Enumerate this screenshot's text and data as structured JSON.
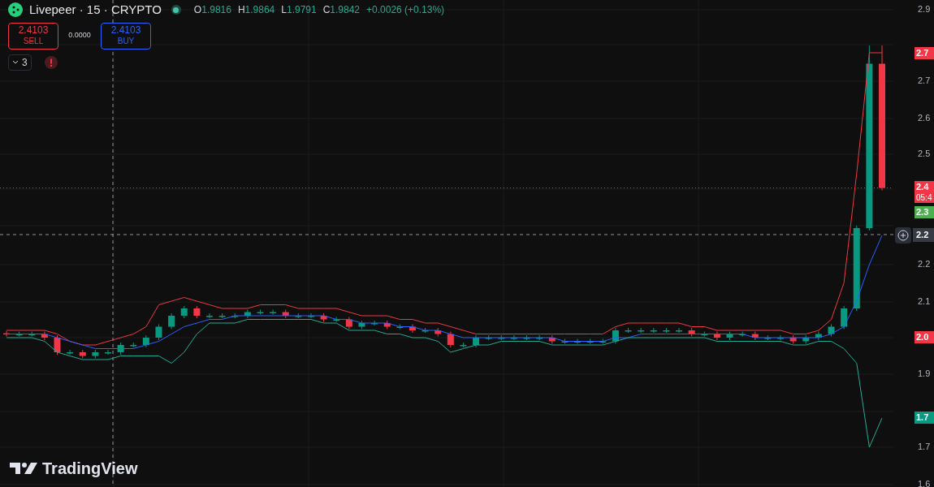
{
  "header": {
    "symbol": "Livepeer · 15 · CRYPTO",
    "market_open": true,
    "ohlc": [
      {
        "label": "O",
        "value": "1.9816"
      },
      {
        "label": "H",
        "value": "1.9864"
      },
      {
        "label": "L",
        "value": "1.9791"
      },
      {
        "label": "C",
        "value": "1.9842"
      }
    ],
    "change": "+0.0026 (+0.13%)"
  },
  "trade": {
    "sell": {
      "price": "2.4103",
      "label": "SELL"
    },
    "spread": "0.0000",
    "buy": {
      "price": "2.4103",
      "label": "BUY"
    }
  },
  "indicators": {
    "count": "3",
    "warning": true
  },
  "chart": {
    "price_axis": [
      "2.9",
      "2.7",
      "2.6",
      "2.5",
      "2.2",
      "2.1",
      "1.9",
      "1.7",
      "1.6"
    ],
    "badges": [
      {
        "text": "2.7",
        "color": "#f23645"
      },
      {
        "text": "2.4",
        "sub": "05:4",
        "color": "#f23645"
      },
      {
        "text": "2.3",
        "color": "#4caf50"
      },
      {
        "text": "2.0",
        "color": "#f23645"
      },
      {
        "text": "1.7",
        "color": "#089981"
      }
    ],
    "crosshair": {
      "label": "2.2"
    }
  },
  "logo": "TradingView"
}
